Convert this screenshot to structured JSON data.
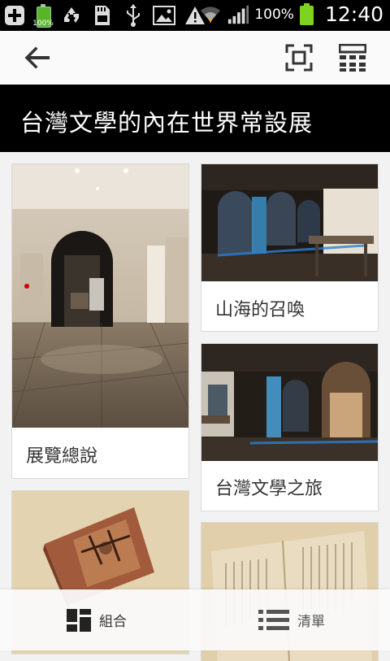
{
  "status_bar": {
    "battery_small_percent": "100%",
    "battery_percent": "100%",
    "time": "12:40",
    "icons": [
      "add-icon",
      "battery-icon",
      "recycle-icon",
      "sd-card-icon",
      "usb-icon",
      "image-icon",
      "warning-icon",
      "wifi-icon",
      "signal-icon"
    ]
  },
  "toolbar": {
    "back_icon": "arrow-left-icon",
    "scan_icon": "scan-icon",
    "qr_icon": "qr-grid-icon"
  },
  "page": {
    "title": "台灣文學的內在世界常設展"
  },
  "cards": [
    {
      "label": "展覽總說"
    },
    {
      "label": "山海的召喚"
    },
    {
      "label": "台灣文學之旅"
    },
    {
      "label": ""
    },
    {
      "label": ""
    }
  ],
  "bottom_nav": {
    "grid_label": "組合",
    "list_label": "清單"
  }
}
